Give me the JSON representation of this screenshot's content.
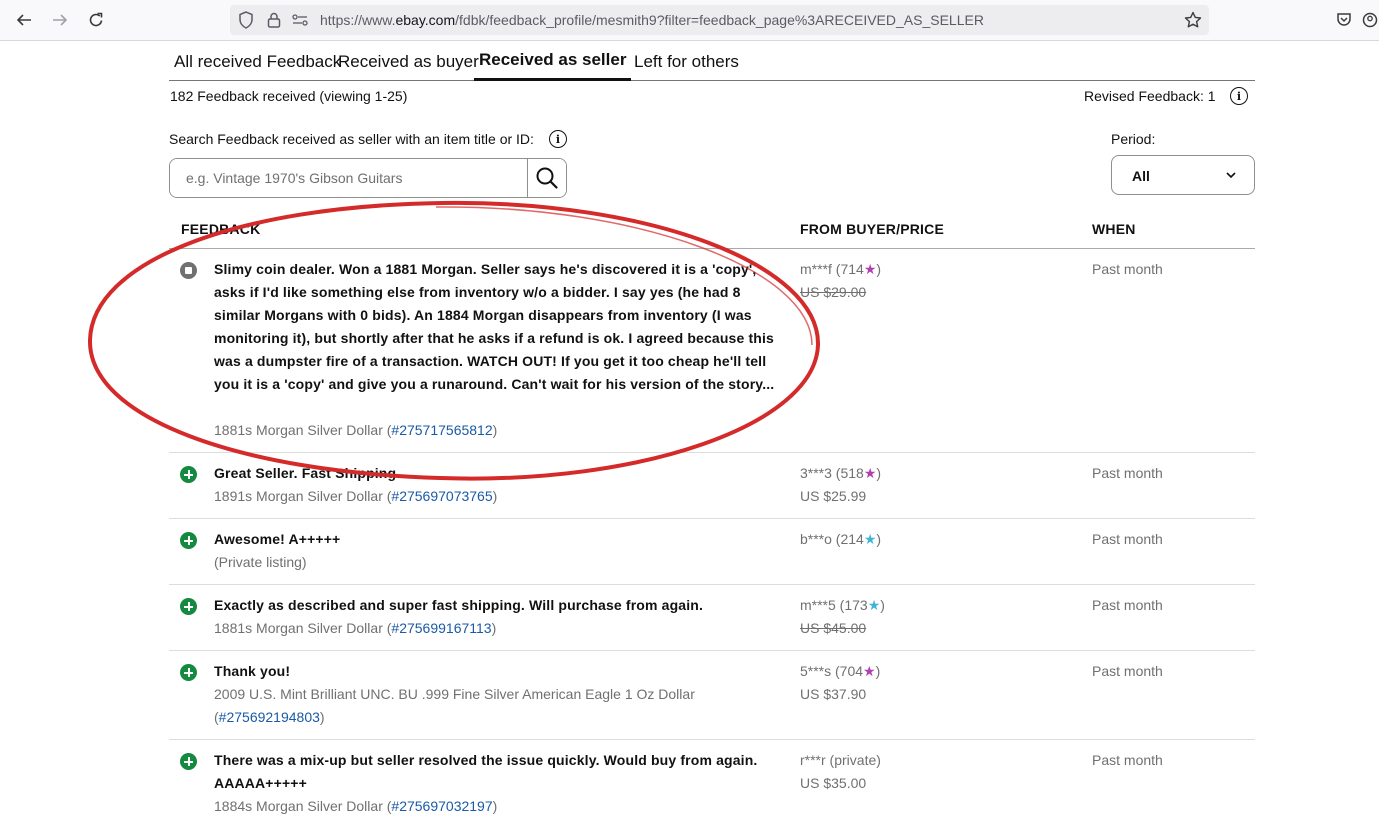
{
  "browser": {
    "url_prefix": "https://www.",
    "url_host": "ebay.com",
    "url_path": "/fdbk/feedback_profile/mesmith9?filter=feedback_page%3ARECEIVED_AS_SELLER"
  },
  "tabs": [
    {
      "label": "All received Feedback",
      "active": false
    },
    {
      "label": "Received as buyer",
      "active": false
    },
    {
      "label": "Received as seller",
      "active": true
    },
    {
      "label": "Left for others",
      "active": false
    }
  ],
  "summary": {
    "count_text": "182 Feedback received (viewing 1-25)",
    "revised_text": "Revised Feedback: 1"
  },
  "search": {
    "label": "Search Feedback received as seller with an item title or ID:",
    "placeholder": "e.g. Vintage 1970's Gibson Guitars"
  },
  "period": {
    "label": "Period:",
    "value": "All"
  },
  "columns": {
    "feedback": "FEEDBACK",
    "from": "FROM BUYER/PRICE",
    "when": "WHEN"
  },
  "rows": [
    {
      "status": "neutral",
      "comment": "Slimy coin dealer. Won a 1881 Morgan. Seller says he's discovered it is a 'copy', asks if I'd like something else from inventory w/o a bidder. I say yes (he had 8 similar Morgans with 0 bids). An 1884 Morgan disappears from inventory (I was monitoring it), but shortly after that he asks if a refund is ok. I agreed because this was a dumpster fire of a transaction. WATCH OUT! If you get it too cheap he'll tell you it is a 'copy' and give you a runaround. Can't wait for his version of the story...",
      "item_title": "1881s Morgan Silver Dollar (",
      "item_id": "#275717565812",
      "item_close": ")",
      "buyer": "m***f (714",
      "buyer_close": ")",
      "star_color": "purple",
      "price": "US $29.00",
      "price_struck": true,
      "when": "Past month"
    },
    {
      "status": "positive",
      "comment": "Great Seller. Fast Shipping.",
      "item_title": "1891s Morgan Silver Dollar (",
      "item_id": "#275697073765",
      "item_close": ")",
      "buyer": "3***3 (518",
      "buyer_close": ")",
      "star_color": "purple",
      "price": "US $25.99",
      "price_struck": false,
      "when": "Past month"
    },
    {
      "status": "positive",
      "comment": "Awesome! A+++++",
      "item_title": "(Private listing)",
      "item_id": "",
      "item_close": "",
      "buyer": "b***o (214",
      "buyer_close": ")",
      "star_color": "teal",
      "price": "",
      "price_struck": false,
      "when": "Past month"
    },
    {
      "status": "positive",
      "comment": "Exactly as described and super fast shipping. Will purchase from again.",
      "item_title": "1881s Morgan Silver Dollar (",
      "item_id": "#275699167113",
      "item_close": ")",
      "buyer": "m***5 (173",
      "buyer_close": ")",
      "star_color": "teal",
      "price": "US $45.00",
      "price_struck": true,
      "when": "Past month"
    },
    {
      "status": "positive",
      "comment": "Thank you!",
      "item_title": "2009 U.S. Mint Brilliant UNC. BU .999 Fine Silver American Eagle 1 Oz Dollar (",
      "item_id": "#275692194803",
      "item_close": ")",
      "buyer": "5***s (704",
      "buyer_close": ")",
      "star_color": "purple",
      "price": "US $37.90",
      "price_struck": false,
      "when": "Past month"
    },
    {
      "status": "positive",
      "comment": "There was a mix-up but seller resolved the issue quickly. Would buy from again. AAAAA+++++",
      "item_title": "1884s Morgan Silver Dollar (",
      "item_id": "#275697032197",
      "item_close": ")",
      "buyer": "r***r (private)",
      "buyer_close": "",
      "star_color": "",
      "price": "US $35.00",
      "price_struck": false,
      "when": "Past month"
    }
  ],
  "colors": {
    "positive": "#138a3f",
    "neutral": "#707070",
    "link": "#1a5aa6",
    "annotation": "#d42a2a"
  }
}
